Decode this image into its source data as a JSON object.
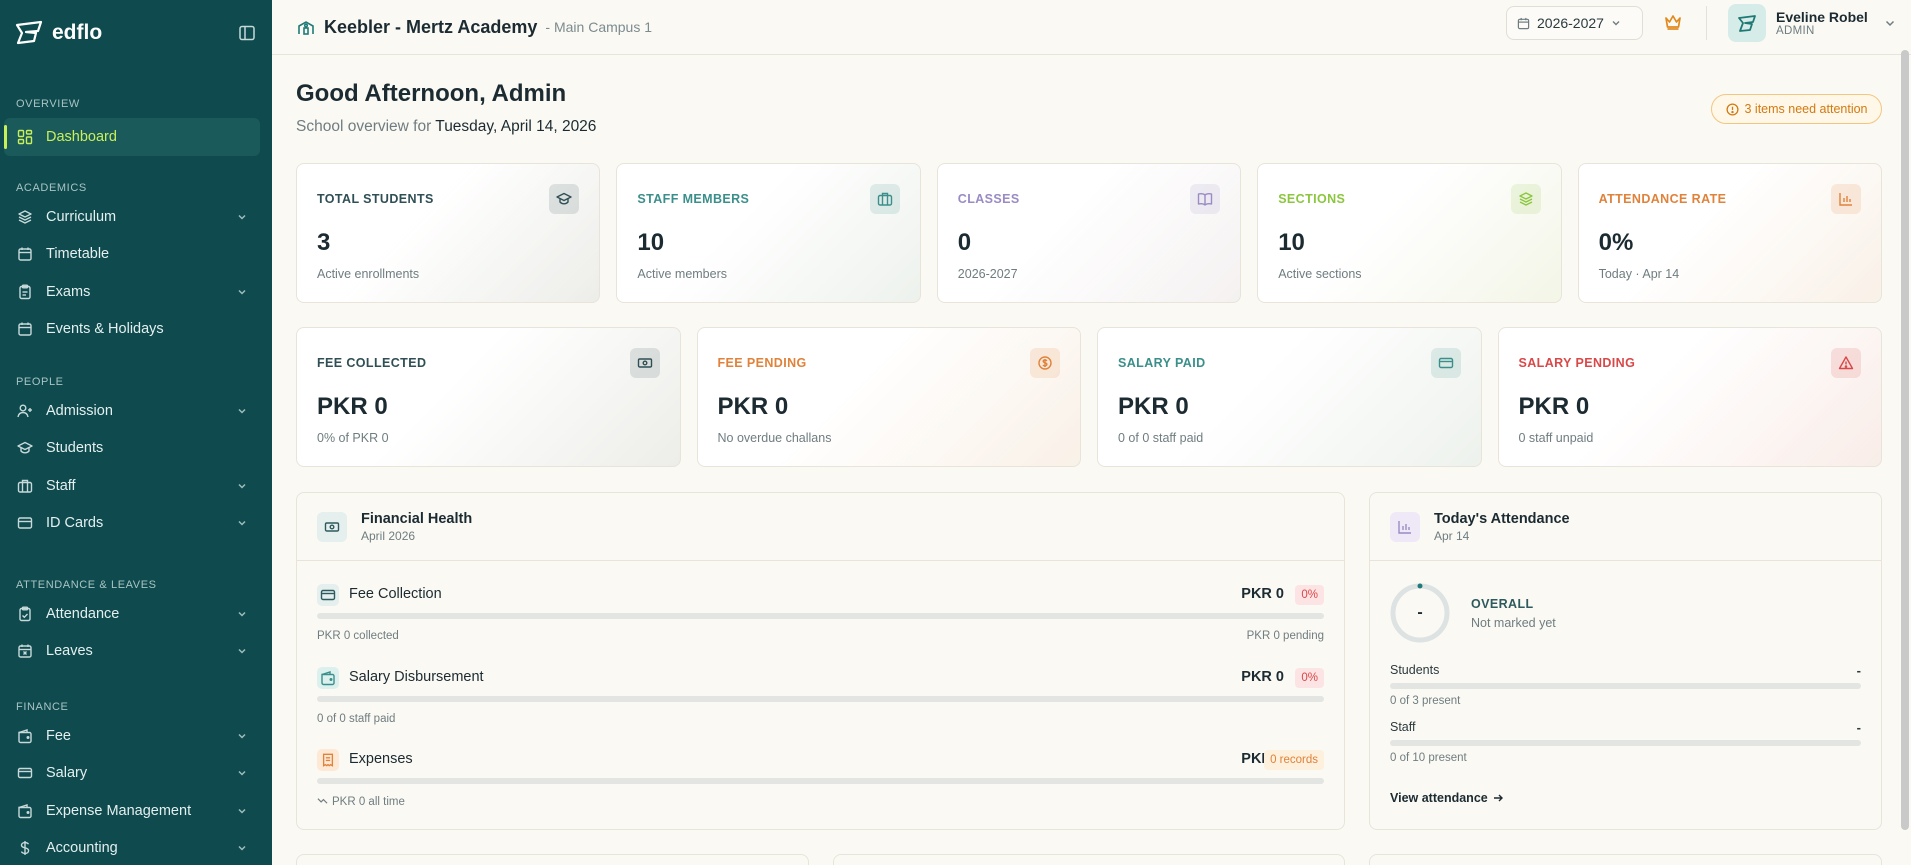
{
  "app": {
    "logo_text": "edflo"
  },
  "sidebar": {
    "sections": [
      {
        "heading": "OVERVIEW",
        "items": [
          {
            "label": "Dashboard",
            "icon": "dashboard-icon",
            "active": true
          }
        ]
      },
      {
        "heading": "ACADEMICS",
        "items": [
          {
            "label": "Curriculum",
            "icon": "layers-icon",
            "expandable": true
          },
          {
            "label": "Timetable",
            "icon": "calendar-icon"
          },
          {
            "label": "Exams",
            "icon": "clipboard-icon",
            "expandable": true
          },
          {
            "label": "Events & Holidays",
            "icon": "calendar-icon"
          }
        ]
      },
      {
        "heading": "PEOPLE",
        "items": [
          {
            "label": "Admission",
            "icon": "user-plus-icon",
            "expandable": true
          },
          {
            "label": "Students",
            "icon": "graduation-cap-icon"
          },
          {
            "label": "Staff",
            "icon": "briefcase-icon",
            "expandable": true
          },
          {
            "label": "ID Cards",
            "icon": "id-card-icon",
            "expandable": true
          }
        ]
      },
      {
        "heading": "ATTENDANCE & LEAVES",
        "items": [
          {
            "label": "Attendance",
            "icon": "clipboard-check-icon",
            "expandable": true
          },
          {
            "label": "Leaves",
            "icon": "calendar-x-icon",
            "expandable": true
          }
        ]
      },
      {
        "heading": "FINANCE",
        "items": [
          {
            "label": "Fee",
            "icon": "wallet-icon",
            "expandable": true
          },
          {
            "label": "Salary",
            "icon": "credit-card-icon",
            "expandable": true
          },
          {
            "label": "Expense Management",
            "icon": "wallet-icon",
            "expandable": true
          },
          {
            "label": "Accounting",
            "icon": "dollar-icon",
            "expandable": true
          }
        ]
      }
    ]
  },
  "header": {
    "school_name": "Keebler - Mertz Academy",
    "campus": "- Main Campus 1",
    "academic_year": "2026-2027",
    "user": {
      "name": "Eveline Robel",
      "role": "ADMIN"
    }
  },
  "main": {
    "greeting": "Good Afternoon, Admin",
    "overview_prefix": "School overview for",
    "overview_date": "Tuesday, April 14, 2026",
    "attention": "3 items need attention",
    "stats_row1": [
      {
        "label": "TOTAL STUDENTS",
        "value": "3",
        "sub": "Active enrollments",
        "color": "#2f4f55",
        "icon": "graduation-cap-icon"
      },
      {
        "label": "STAFF MEMBERS",
        "value": "10",
        "sub": "Active members",
        "color": "#3a8f8a",
        "icon": "briefcase-icon"
      },
      {
        "label": "CLASSES",
        "value": "0",
        "sub": "2026-2027",
        "color": "#9a8bc4",
        "icon": "book-icon"
      },
      {
        "label": "SECTIONS",
        "value": "10",
        "sub": "Active sections",
        "color": "#8cc63f",
        "icon": "layers-icon"
      },
      {
        "label": "ATTENDANCE RATE",
        "value": "0%",
        "sub": "Today · Apr 14",
        "color": "#e0823a",
        "icon": "bar-chart-icon"
      }
    ],
    "stats_row2": [
      {
        "label": "FEE COLLECTED",
        "value": "PKR 0",
        "sub": "0% of PKR 0",
        "color": "#2f4f55",
        "icon": "cash-icon"
      },
      {
        "label": "FEE PENDING",
        "value": "PKR 0",
        "sub": "No overdue challans",
        "color": "#e0823a",
        "icon": "coin-icon"
      },
      {
        "label": "SALARY PAID",
        "value": "PKR 0",
        "sub": "0 of 0 staff paid",
        "color": "#3a8f8a",
        "icon": "credit-card-icon"
      },
      {
        "label": "SALARY PENDING",
        "value": "PKR 0",
        "sub": "0 staff unpaid",
        "color": "#d94848",
        "icon": "alert-triangle-icon"
      }
    ],
    "financial_health": {
      "title": "Financial Health",
      "subtitle": "April 2026",
      "rows": [
        {
          "title": "Fee Collection",
          "amount": "PKR 0",
          "pill": "0%",
          "progress": 0,
          "note_left": "PKR 0 collected",
          "note_right": "PKR 0 pending"
        },
        {
          "title": "Salary Disbursement",
          "amount": "PKR 0",
          "pill": "0%",
          "progress": 0,
          "note_left": "0 of 0 staff paid",
          "note_right": ""
        },
        {
          "title": "Expenses",
          "amount": "PKR 0",
          "pill": "0 records",
          "progress": 0,
          "note_left": "PKR 0 all time",
          "note_right": ""
        }
      ]
    },
    "attendance": {
      "title": "Today's Attendance",
      "subtitle": "Apr 14",
      "ring_value": "-",
      "overall_label": "OVERALL",
      "overall_sub": "Not marked yet",
      "students": {
        "label": "Students",
        "value": "-",
        "note": "0 of 3 present",
        "progress": 0
      },
      "staff": {
        "label": "Staff",
        "value": "-",
        "note": "0 of 10 present",
        "progress": 0
      },
      "link": "View attendance"
    }
  }
}
